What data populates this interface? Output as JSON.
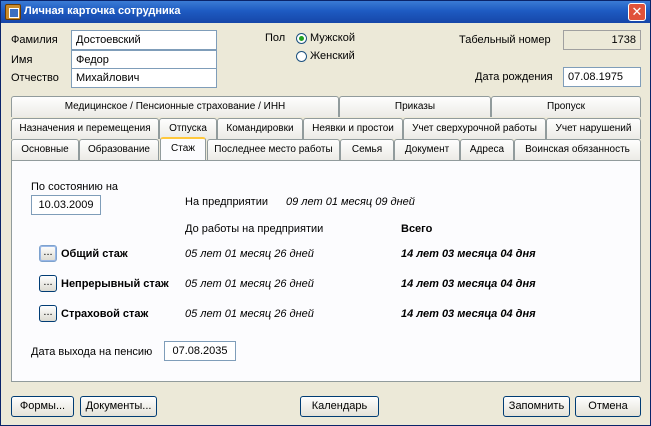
{
  "window": {
    "title": "Личная карточка сотрудника",
    "close": "✕"
  },
  "person": {
    "surname_label": "Фамилия",
    "surname": "Достоевский",
    "name_label": "Имя",
    "name": "Федор",
    "patronymic_label": "Отчество",
    "patronymic": "Михайлович",
    "sex_label": "Пол",
    "sex_male": "Мужской",
    "sex_female": "Женский",
    "sex_selected": "Мужской",
    "tabnum_label": "Табельный номер",
    "tabnum": "1738",
    "birth_label": "Дата рождения",
    "birth": "07.08.1975"
  },
  "tabs_row1": [
    "Медицинское / Пенсионные страхование / ИНН",
    "Приказы",
    "Пропуск"
  ],
  "tabs_row2": [
    "Назначения и перемещения",
    "Отпуска",
    "Командировки",
    "Неявки и простои",
    "Учет сверхурочной работы",
    "Учет нарушений"
  ],
  "tabs_row3": [
    "Основные",
    "Образование",
    "Стаж",
    "Последнее место работы",
    "Семья",
    "Документ",
    "Адреса",
    "Воинская обязанность"
  ],
  "active_tab": "Стаж",
  "stazh": {
    "as_of_label": "По состоянию на",
    "as_of": "10.03.2009",
    "at_enterprise_label": "На предприятии",
    "at_enterprise": "09 лет 01 месяц 09 дней",
    "before_label": "До работы на предприятии",
    "total_label": "Всего",
    "rows": [
      {
        "label": "Общий стаж",
        "before": "05 лет 01 месяц 26 дней",
        "total": "14 лет 03 месяца 04 дня"
      },
      {
        "label": "Непрерывный стаж",
        "before": "05 лет 01 месяц 26 дней",
        "total": "14 лет 03 месяца 04 дня"
      },
      {
        "label": "Страховой стаж",
        "before": "05 лет 01 месяц 26 дней",
        "total": "14 лет 03 месяца 04 дня"
      }
    ],
    "dots": "...",
    "pension_label": "Дата выхода на пенсию",
    "pension_date": "07.08.2035"
  },
  "buttons": {
    "forms": "Формы...",
    "documents": "Документы...",
    "calendar": "Календарь",
    "save": "Запомнить",
    "cancel": "Отмена"
  }
}
